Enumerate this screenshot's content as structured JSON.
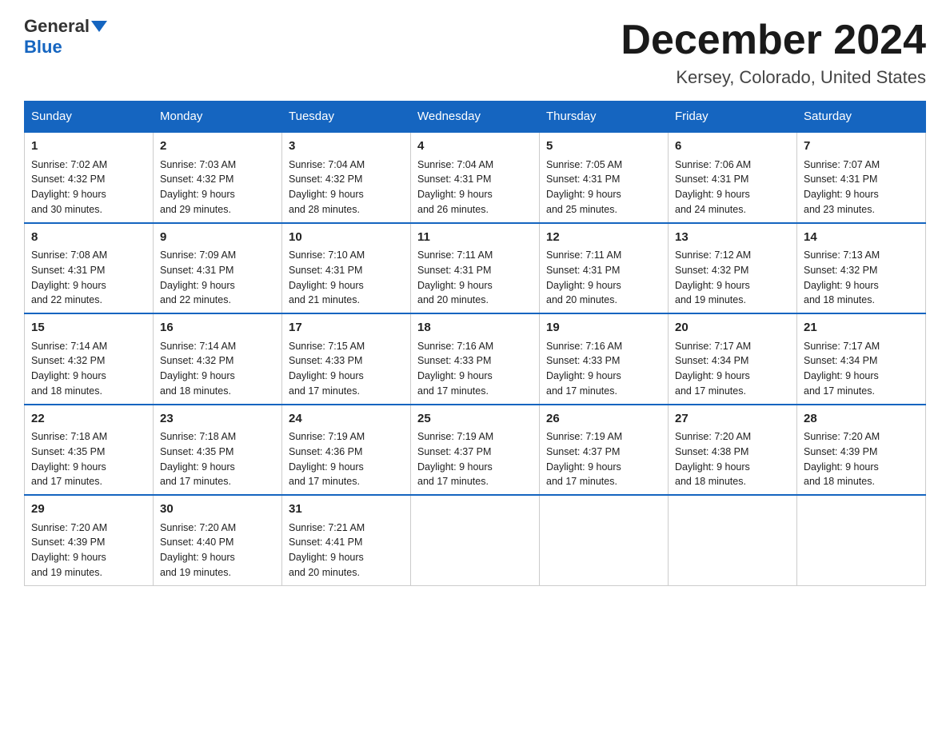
{
  "header": {
    "logo_general": "General",
    "logo_blue": "Blue",
    "month_title": "December 2024",
    "location": "Kersey, Colorado, United States"
  },
  "days_of_week": [
    "Sunday",
    "Monday",
    "Tuesday",
    "Wednesday",
    "Thursday",
    "Friday",
    "Saturday"
  ],
  "weeks": [
    [
      {
        "day": "1",
        "sunrise": "7:02 AM",
        "sunset": "4:32 PM",
        "daylight": "9 hours and 30 minutes."
      },
      {
        "day": "2",
        "sunrise": "7:03 AM",
        "sunset": "4:32 PM",
        "daylight": "9 hours and 29 minutes."
      },
      {
        "day": "3",
        "sunrise": "7:04 AM",
        "sunset": "4:32 PM",
        "daylight": "9 hours and 28 minutes."
      },
      {
        "day": "4",
        "sunrise": "7:04 AM",
        "sunset": "4:31 PM",
        "daylight": "9 hours and 26 minutes."
      },
      {
        "day": "5",
        "sunrise": "7:05 AM",
        "sunset": "4:31 PM",
        "daylight": "9 hours and 25 minutes."
      },
      {
        "day": "6",
        "sunrise": "7:06 AM",
        "sunset": "4:31 PM",
        "daylight": "9 hours and 24 minutes."
      },
      {
        "day": "7",
        "sunrise": "7:07 AM",
        "sunset": "4:31 PM",
        "daylight": "9 hours and 23 minutes."
      }
    ],
    [
      {
        "day": "8",
        "sunrise": "7:08 AM",
        "sunset": "4:31 PM",
        "daylight": "9 hours and 22 minutes."
      },
      {
        "day": "9",
        "sunrise": "7:09 AM",
        "sunset": "4:31 PM",
        "daylight": "9 hours and 22 minutes."
      },
      {
        "day": "10",
        "sunrise": "7:10 AM",
        "sunset": "4:31 PM",
        "daylight": "9 hours and 21 minutes."
      },
      {
        "day": "11",
        "sunrise": "7:11 AM",
        "sunset": "4:31 PM",
        "daylight": "9 hours and 20 minutes."
      },
      {
        "day": "12",
        "sunrise": "7:11 AM",
        "sunset": "4:31 PM",
        "daylight": "9 hours and 20 minutes."
      },
      {
        "day": "13",
        "sunrise": "7:12 AM",
        "sunset": "4:32 PM",
        "daylight": "9 hours and 19 minutes."
      },
      {
        "day": "14",
        "sunrise": "7:13 AM",
        "sunset": "4:32 PM",
        "daylight": "9 hours and 18 minutes."
      }
    ],
    [
      {
        "day": "15",
        "sunrise": "7:14 AM",
        "sunset": "4:32 PM",
        "daylight": "9 hours and 18 minutes."
      },
      {
        "day": "16",
        "sunrise": "7:14 AM",
        "sunset": "4:32 PM",
        "daylight": "9 hours and 18 minutes."
      },
      {
        "day": "17",
        "sunrise": "7:15 AM",
        "sunset": "4:33 PM",
        "daylight": "9 hours and 17 minutes."
      },
      {
        "day": "18",
        "sunrise": "7:16 AM",
        "sunset": "4:33 PM",
        "daylight": "9 hours and 17 minutes."
      },
      {
        "day": "19",
        "sunrise": "7:16 AM",
        "sunset": "4:33 PM",
        "daylight": "9 hours and 17 minutes."
      },
      {
        "day": "20",
        "sunrise": "7:17 AM",
        "sunset": "4:34 PM",
        "daylight": "9 hours and 17 minutes."
      },
      {
        "day": "21",
        "sunrise": "7:17 AM",
        "sunset": "4:34 PM",
        "daylight": "9 hours and 17 minutes."
      }
    ],
    [
      {
        "day": "22",
        "sunrise": "7:18 AM",
        "sunset": "4:35 PM",
        "daylight": "9 hours and 17 minutes."
      },
      {
        "day": "23",
        "sunrise": "7:18 AM",
        "sunset": "4:35 PM",
        "daylight": "9 hours and 17 minutes."
      },
      {
        "day": "24",
        "sunrise": "7:19 AM",
        "sunset": "4:36 PM",
        "daylight": "9 hours and 17 minutes."
      },
      {
        "day": "25",
        "sunrise": "7:19 AM",
        "sunset": "4:37 PM",
        "daylight": "9 hours and 17 minutes."
      },
      {
        "day": "26",
        "sunrise": "7:19 AM",
        "sunset": "4:37 PM",
        "daylight": "9 hours and 17 minutes."
      },
      {
        "day": "27",
        "sunrise": "7:20 AM",
        "sunset": "4:38 PM",
        "daylight": "9 hours and 18 minutes."
      },
      {
        "day": "28",
        "sunrise": "7:20 AM",
        "sunset": "4:39 PM",
        "daylight": "9 hours and 18 minutes."
      }
    ],
    [
      {
        "day": "29",
        "sunrise": "7:20 AM",
        "sunset": "4:39 PM",
        "daylight": "9 hours and 19 minutes."
      },
      {
        "day": "30",
        "sunrise": "7:20 AM",
        "sunset": "4:40 PM",
        "daylight": "9 hours and 19 minutes."
      },
      {
        "day": "31",
        "sunrise": "7:21 AM",
        "sunset": "4:41 PM",
        "daylight": "9 hours and 20 minutes."
      },
      null,
      null,
      null,
      null
    ]
  ],
  "labels": {
    "sunrise": "Sunrise:",
    "sunset": "Sunset:",
    "daylight": "Daylight:"
  }
}
